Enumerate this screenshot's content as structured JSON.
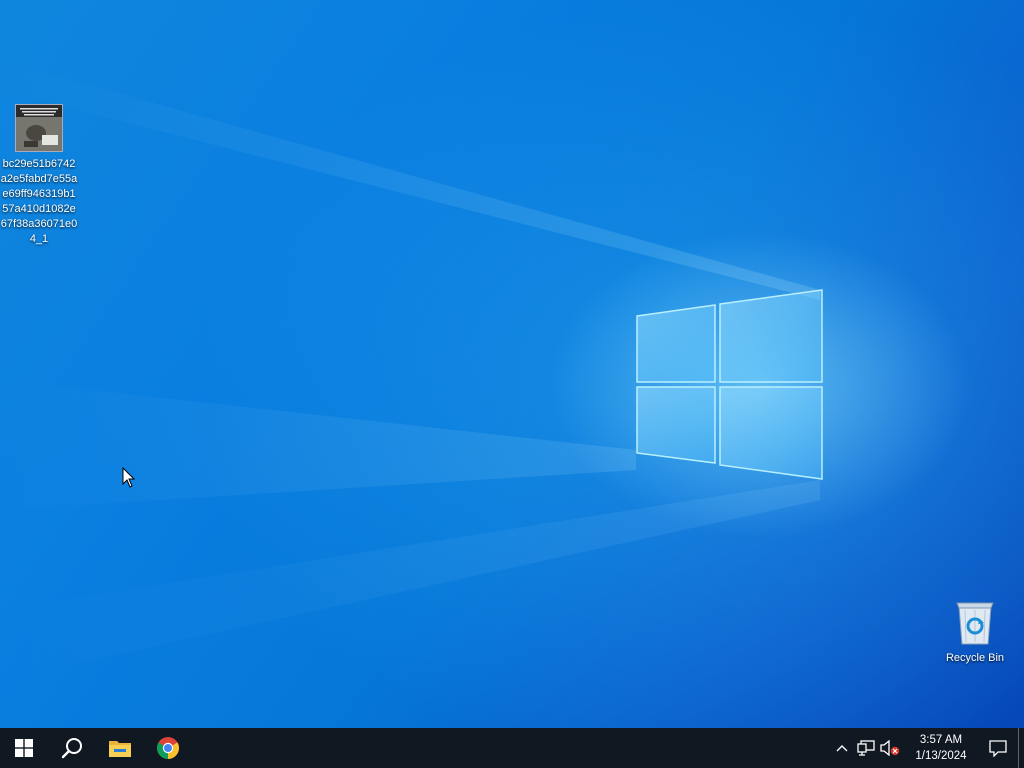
{
  "desktop": {
    "icons": [
      {
        "label": "bc29e51b6742a2e5fabd7e55ae69ff946319b157a410d1082e67f38a36071e04_1",
        "icon": "image-file-icon"
      },
      {
        "label": "Recycle Bin",
        "icon": "recycle-bin-icon"
      }
    ]
  },
  "taskbar": {
    "items": [
      {
        "icon": "windows-start-icon"
      },
      {
        "icon": "search-icon"
      },
      {
        "icon": "file-explorer-icon"
      },
      {
        "icon": "chrome-icon"
      }
    ],
    "tray": {
      "icons": [
        "chevron-up-icon",
        "network-icon",
        "volume-muted-icon"
      ],
      "time": "3:57 AM",
      "date": "1/13/2024",
      "notification_icon": "action-center-icon"
    }
  },
  "colors": {
    "taskbar": "#101822",
    "wallpaper_blue": "#0a78d8",
    "logo_glow": "#8fdcff"
  }
}
